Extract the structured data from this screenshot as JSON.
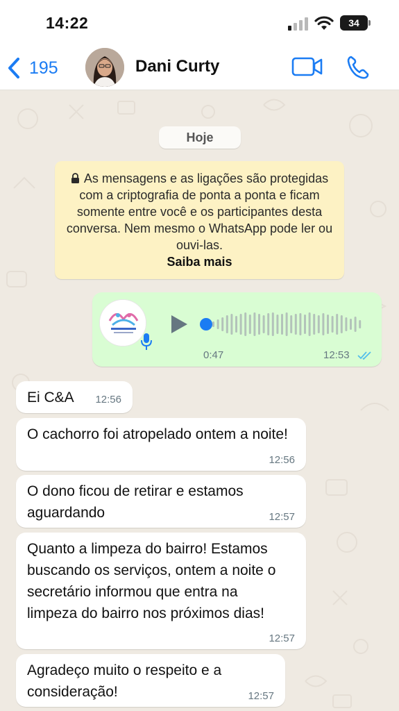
{
  "status_bar": {
    "time": "14:22",
    "battery": "34"
  },
  "header": {
    "back_count": "195",
    "contact_name": "Dani Curty"
  },
  "chat": {
    "date_chip": "Hoje",
    "encryption_notice": "As mensagens e as ligações são protegidas com a criptografia de ponta a ponta e ficam somente entre você e os participantes desta conversa. Nem mesmo o WhatsApp pode ler ou ouvi-las.",
    "encryption_link": "Saiba mais",
    "voice_message": {
      "duration": "0:47",
      "time": "12:53",
      "status": "read",
      "progress": 0.0
    },
    "messages": [
      {
        "text": "Ei C&A",
        "time": "12:56"
      },
      {
        "text": "O cachorro foi atropelado ontem a noite!",
        "time": "12:56"
      },
      {
        "text": "O dono ficou de retirar e estamos aguardando",
        "time": "12:57"
      },
      {
        "text": "Quanto a limpeza do bairro! Estamos buscando os serviços, ontem a noite o secretário informou que entra na limpeza do bairro nos próximos dias!",
        "time": "12:57"
      },
      {
        "text": "Agradeço muito o respeito e a consideração!",
        "time": "12:57"
      }
    ]
  },
  "colors": {
    "accent": "#1b7cf3",
    "outgoing_bubble": "#d9fdd3",
    "incoming_bubble": "#ffffff",
    "encryption_bg": "#fdf2c4",
    "chat_bg": "#efeae2",
    "read_ticks": "#53bdeb"
  },
  "icons": [
    "back-chevron-icon",
    "video-call-icon",
    "phone-icon",
    "lock-icon",
    "play-icon",
    "mic-icon",
    "double-check-icon",
    "signal-icon",
    "wifi-icon",
    "battery-icon"
  ]
}
